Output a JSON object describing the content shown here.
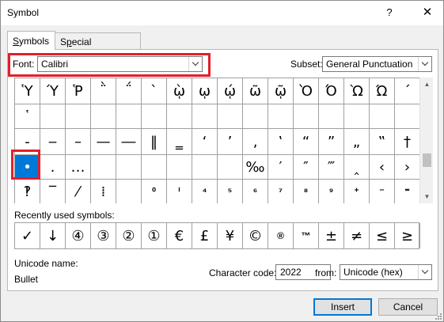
{
  "window": {
    "title": "Symbol",
    "help_label": "?",
    "close_label": "✕"
  },
  "tabs": [
    {
      "label": "Symbols",
      "active": true
    },
    {
      "label": "Special Characters",
      "active": false
    }
  ],
  "font": {
    "label": "Font:",
    "value": "Calibri"
  },
  "subset": {
    "label": "Subset:",
    "value": "General Punctuation"
  },
  "grid": {
    "rows": [
      [
        "Ὑ",
        "Ύ",
        "Ῥ",
        "῭",
        "΅",
        "`",
        "ῲ",
        "ῳ",
        "ῴ",
        "ῶ",
        "ῷ",
        "Ὸ",
        "Ό",
        "Ὼ",
        "Ώ",
        "´"
      ],
      [
        "῾",
        "",
        "",
        "",
        "",
        "",
        "",
        "",
        "",
        "",
        "",
        "",
        "",
        "",
        "",
        ""
      ],
      [
        "‐",
        "‒",
        "–",
        "—",
        "―",
        "‖",
        "‗",
        "‘",
        "’",
        "‚",
        "‛",
        "“",
        "”",
        "„",
        "‟",
        "†",
        "‡"
      ],
      [
        "•",
        "․",
        "…",
        "",
        "",
        "",
        "",
        "",
        "",
        "‰",
        "′",
        "″",
        "‴",
        "‸",
        "‹",
        "›",
        "‼"
      ],
      [
        "‽",
        "‾",
        "⁄",
        "⁞",
        "",
        "⁰",
        "ⁱ",
        "⁴",
        "⁵",
        "⁶",
        "⁷",
        "⁸",
        "⁹",
        "⁺",
        "⁻",
        "⁼",
        "⁽"
      ]
    ],
    "selected_row": 3,
    "selected_col": 0
  },
  "recent": {
    "label": "Recently used symbols:",
    "symbols": [
      "✓",
      "↓",
      "④",
      "③",
      "②",
      "①",
      "€",
      "£",
      "¥",
      "©",
      "®",
      "™",
      "±",
      "≠",
      "≤",
      "≥",
      "÷"
    ]
  },
  "unicode": {
    "label": "Unicode name:",
    "value": "Bullet"
  },
  "char_code": {
    "label": "Character code:",
    "value": "2022"
  },
  "from": {
    "label": "from:",
    "value": "Unicode (hex)"
  },
  "buttons": {
    "insert": "Insert",
    "cancel": "Cancel"
  },
  "colors": {
    "selection": "#0078d7",
    "highlight": "#e0202c"
  }
}
